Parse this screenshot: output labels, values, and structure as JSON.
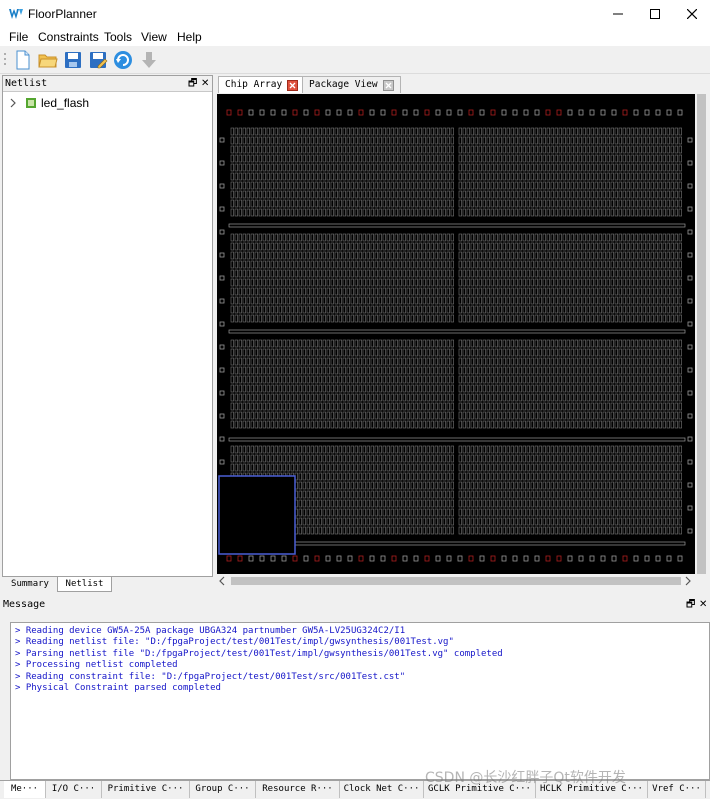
{
  "window": {
    "title": "FloorPlanner"
  },
  "menu": [
    "File",
    "Constraints",
    "Tools",
    "View",
    "Help"
  ],
  "toolbar": {
    "icons": [
      "new-file-icon",
      "open-folder-icon",
      "save-icon",
      "save-as-icon",
      "refresh-icon",
      "download-icon"
    ]
  },
  "netlist_panel": {
    "title": "Netlist",
    "tree_items": [
      {
        "label": "led_flash"
      }
    ],
    "tabs": [
      "Summary",
      "Netlist"
    ],
    "active_tab": "Netlist"
  },
  "editor": {
    "tabs": [
      {
        "label": "Chip Array",
        "active": true
      },
      {
        "label": "Package View",
        "active": false
      }
    ]
  },
  "message_panel": {
    "title": "Message",
    "lines": [
      "> Reading device GW5A-25A package UBGA324 partnumber GW5A-LV25UG324C2/I1",
      "> Reading netlist file: \"D:/fpgaProject/test/001Test/impl/gwsynthesis/001Test.vg\"",
      "> Parsing netlist file \"D:/fpgaProject/test/001Test/impl/gwsynthesis/001Test.vg\" completed",
      "> Processing netlist completed",
      "> Reading constraint file: \"D:/fpgaProject/test/001Test/src/001Test.cst\"",
      "> Physical Constraint parsed completed"
    ],
    "tabs": [
      "Me···",
      "I/O C···",
      "Primitive C···",
      "Group C···",
      "Resource R···",
      "Clock Net C···",
      "GCLK Primitive C···",
      "HCLK Primitive C···",
      "Vref C···"
    ]
  },
  "watermark": "CSDN @长沙红胖子Qt软件开发",
  "colors": {
    "canvas": "#000000",
    "cell": "#7a7a7a",
    "io": "#9a9a9a",
    "io_red": "#b02020",
    "message_text": "#1414c8",
    "minimap_border": "#4a5fd6"
  }
}
